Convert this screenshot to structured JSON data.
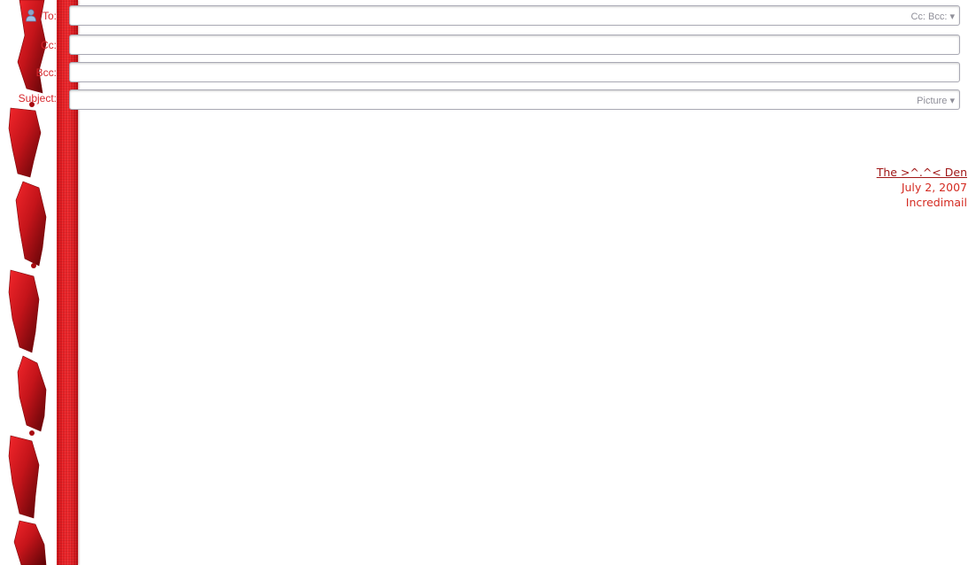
{
  "header": {
    "to_label": "To:",
    "cc_label": "Cc:",
    "bcc_label": "Bcc:",
    "subject_label": "Subject:",
    "to_value": "",
    "cc_value": "",
    "bcc_value": "",
    "subject_value": "",
    "ccbcc_toggle": "Cc: Bcc: ▾",
    "picture_toggle": "Picture ▾"
  },
  "signature": {
    "link": "The >^.^< Den",
    "date": "July 2, 2007",
    "app": "Incredimail"
  },
  "colors": {
    "accent_red": "#e51f24",
    "label_red": "#d6262b",
    "signature_red": "#d42b22"
  },
  "icons": [
    "contact-icon",
    "ribbon-decoration"
  ]
}
